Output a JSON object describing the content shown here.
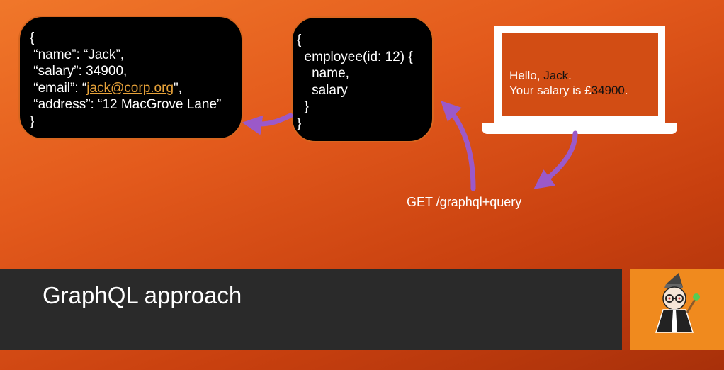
{
  "json_response": {
    "lines": [
      "{",
      " “name”: “Jack”,",
      " “salary”: 34900,",
      " “email”: “",
      " “address”: “12 MacGrove Lane”",
      "}"
    ],
    "email_link": "jack@corp.org",
    "email_suffix": "\","
  },
  "query": {
    "lines": [
      "{",
      "  employee(id: 12) {",
      "    name,",
      "    salary",
      "  }",
      "}"
    ]
  },
  "laptop": {
    "greeting_prefix": "Hello, ",
    "name": "Jack",
    "greeting_suffix": ".",
    "salary_prefix": "Your salary is £",
    "salary": "34900",
    "salary_suffix": "."
  },
  "request_label": "GET /graphql+query",
  "slide_title": "GraphQL approach",
  "colors": {
    "arrow": "#9b59c9",
    "box_border": "#d9661f",
    "title_bar": "#2a2a2a",
    "mascot_bg": "#f08a1e"
  }
}
